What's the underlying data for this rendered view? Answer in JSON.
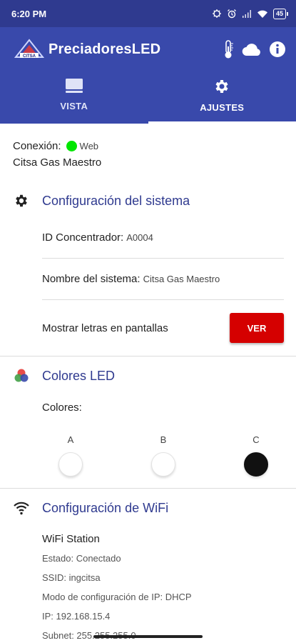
{
  "status_bar": {
    "time": "6:20 PM",
    "battery": "45",
    "icons": [
      "alarm-off-icon",
      "alarm-icon",
      "signal-icon",
      "wifi-icon",
      "battery-icon"
    ]
  },
  "app_bar": {
    "logo_text": "CITSA",
    "title": "PreciadoresLED",
    "actions": [
      "thermometer-icon",
      "cloud-icon",
      "info-icon"
    ]
  },
  "tabs": [
    {
      "label": "VISTA",
      "icon": "monitor-icon",
      "active": false
    },
    {
      "label": "AJUSTES",
      "icon": "gear-icon",
      "active": true
    }
  ],
  "connection": {
    "label": "Conexión:",
    "status": "Web",
    "status_color": "#00e600",
    "system_name": "Citsa Gas Maestro"
  },
  "system_config": {
    "title": "Configuración del sistema",
    "concentrator_label": "ID Concentrador:",
    "concentrator_value": "A0004",
    "system_name_label": "Nombre del sistema:",
    "system_name_value": "Citsa Gas Maestro",
    "show_letters_label": "Mostrar letras en pantallas",
    "view_button": "VER"
  },
  "led_colors": {
    "title": "Colores LED",
    "colors_label": "Colores:",
    "swatches": [
      {
        "letter": "A",
        "color": "#ffffff"
      },
      {
        "letter": "B",
        "color": "#ffffff"
      },
      {
        "letter": "C",
        "color": "#111111"
      }
    ]
  },
  "wifi": {
    "title": "Configuración de WiFi",
    "mode": "WiFi Station",
    "state": "Estado: Conectado",
    "ssid": "SSID: ingcitsa",
    "ip_mode": "Modo de configuración de IP: DHCP",
    "ip": "IP: 192.168.15.4",
    "subnet": "Subnet: 255.255.255.0"
  },
  "theme": {
    "primary": "#3949ab",
    "primary_dark": "#2f3a8f",
    "accent_button": "#d50000"
  }
}
